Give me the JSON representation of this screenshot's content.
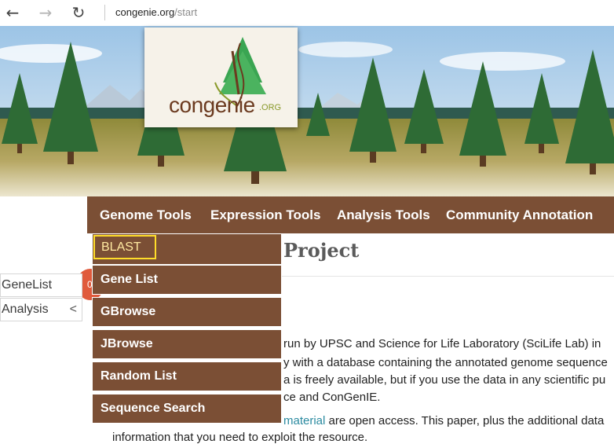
{
  "browser": {
    "back_glyph": "←",
    "forward_glyph": "→",
    "refresh_glyph": "↻",
    "url_host": "congenie.org",
    "url_path": "/start"
  },
  "logo": {
    "text": "congenie",
    "suffix": ".ORG"
  },
  "menu": {
    "items": [
      "Genome Tools",
      "Expression Tools",
      "Analysis Tools",
      "Community Annotation"
    ]
  },
  "dropdown": {
    "items": [
      "BLAST",
      "Gene List",
      "GBrowse",
      "JBrowse",
      "Random List",
      "Sequence Search"
    ]
  },
  "sidebar": {
    "genelist_label": "GeneList",
    "analysis_label": "Analysis",
    "collapse_glyph": "<",
    "badge": "0"
  },
  "content": {
    "title": "Project",
    "lines": [
      "run by UPSC and Science for Life Laboratory (SciLife Lab) in",
      "y with a database containing the annotated genome sequence",
      "a is freely available, but if you use the data in any scientific pu",
      "ce and ConGenIE."
    ],
    "link_text": "material",
    "link_line_rest": " are open access. This paper, plus the additional data",
    "last_line": "information that you need to exploit the resource."
  },
  "colors": {
    "menu_brown": "#7b4f35",
    "highlight_border": "#ffdd2a",
    "link": "#2a8aa0",
    "badge": "#e05a3c"
  },
  "icons": [
    "back-arrow-icon",
    "forward-arrow-icon",
    "refresh-icon",
    "congenie-tree-logo-icon"
  ]
}
